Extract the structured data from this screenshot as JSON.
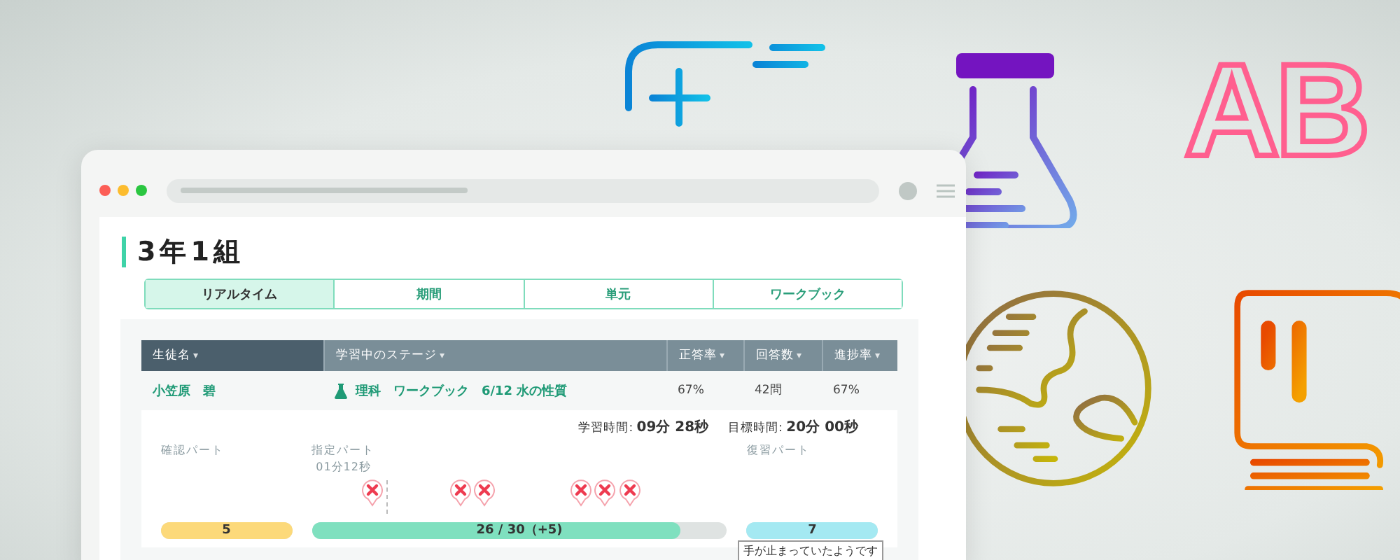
{
  "decoration": {
    "logo_text": "AB"
  },
  "page_title": "3年1組",
  "tabs": [
    {
      "label": "リアルタイム",
      "selected": true
    },
    {
      "label": "期間",
      "selected": false
    },
    {
      "label": "単元",
      "selected": false
    },
    {
      "label": "ワークブック",
      "selected": false
    }
  ],
  "table": {
    "columns": [
      {
        "label": "生徒名",
        "caret": "▾",
        "selected": true
      },
      {
        "label": "学習中のステージ",
        "caret": "▾",
        "selected": false
      },
      {
        "label": "正答率",
        "caret": "▾",
        "selected": false
      },
      {
        "label": "回答数",
        "caret": "▾",
        "selected": false
      },
      {
        "label": "進捗率",
        "caret": "▾",
        "selected": false
      }
    ],
    "rows": [
      {
        "name": "小笠原　碧",
        "subject": "理科",
        "stage": "ワークブック　6/12 水の性質",
        "correct_rate": "67%",
        "answers": "42問",
        "progress": "67%"
      }
    ]
  },
  "detail": {
    "study_time_label": "学習時間:",
    "study_time": "09分 28秒",
    "target_time_label": "目標時間:",
    "target_time": "20分 00秒",
    "marker_time": "01分12秒",
    "parts": [
      {
        "kind": "confirm",
        "label": "確認パート",
        "value": "5",
        "level": 1
      },
      {
        "kind": "assigned",
        "label": "指定パート",
        "value": "26 / 30（+5)",
        "level": 0.886
      },
      {
        "kind": "review",
        "label": "復習パート",
        "value": "7",
        "level": 1
      }
    ],
    "tooltip": "手が止まっていたようです"
  }
}
